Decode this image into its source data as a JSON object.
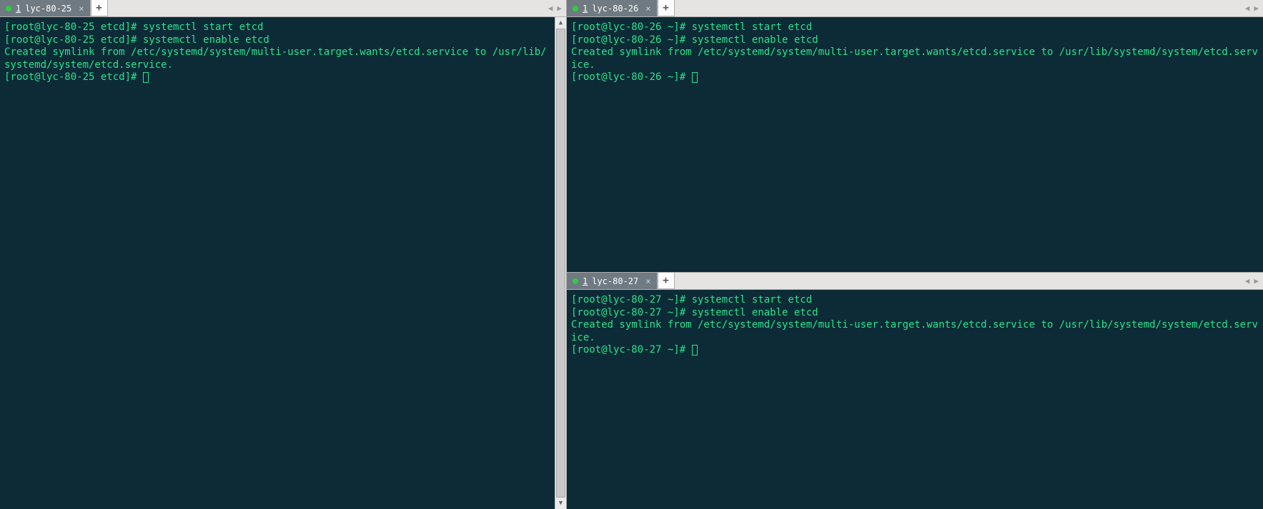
{
  "panes": {
    "left": {
      "tab": {
        "num": "1",
        "title": "lyc-80-25"
      },
      "lines": [
        "[root@lyc-80-25 etcd]# systemctl start etcd",
        "[root@lyc-80-25 etcd]# systemctl enable etcd",
        "Created symlink from /etc/systemd/system/multi-user.target.wants/etcd.service to /usr/lib/systemd/system/etcd.service.",
        "[root@lyc-80-25 etcd]# "
      ]
    },
    "topright": {
      "tab": {
        "num": "1",
        "title": "lyc-80-26"
      },
      "lines": [
        "[root@lyc-80-26 ~]# systemctl start etcd",
        "[root@lyc-80-26 ~]# systemctl enable etcd",
        "Created symlink from /etc/systemd/system/multi-user.target.wants/etcd.service to /usr/lib/systemd/system/etcd.service.",
        "[root@lyc-80-26 ~]# "
      ]
    },
    "bottomright": {
      "tab": {
        "num": "1",
        "title": "lyc-80-27"
      },
      "lines": [
        "[root@lyc-80-27 ~]# systemctl start etcd",
        "[root@lyc-80-27 ~]# systemctl enable etcd",
        "Created symlink from /etc/systemd/system/multi-user.target.wants/etcd.service to /usr/lib/systemd/system/etcd.service.",
        "[root@lyc-80-27 ~]# "
      ]
    }
  },
  "icons": {
    "close": "×",
    "plus": "+",
    "left": "◀",
    "right": "▶",
    "up": "▲",
    "down": "▼"
  }
}
